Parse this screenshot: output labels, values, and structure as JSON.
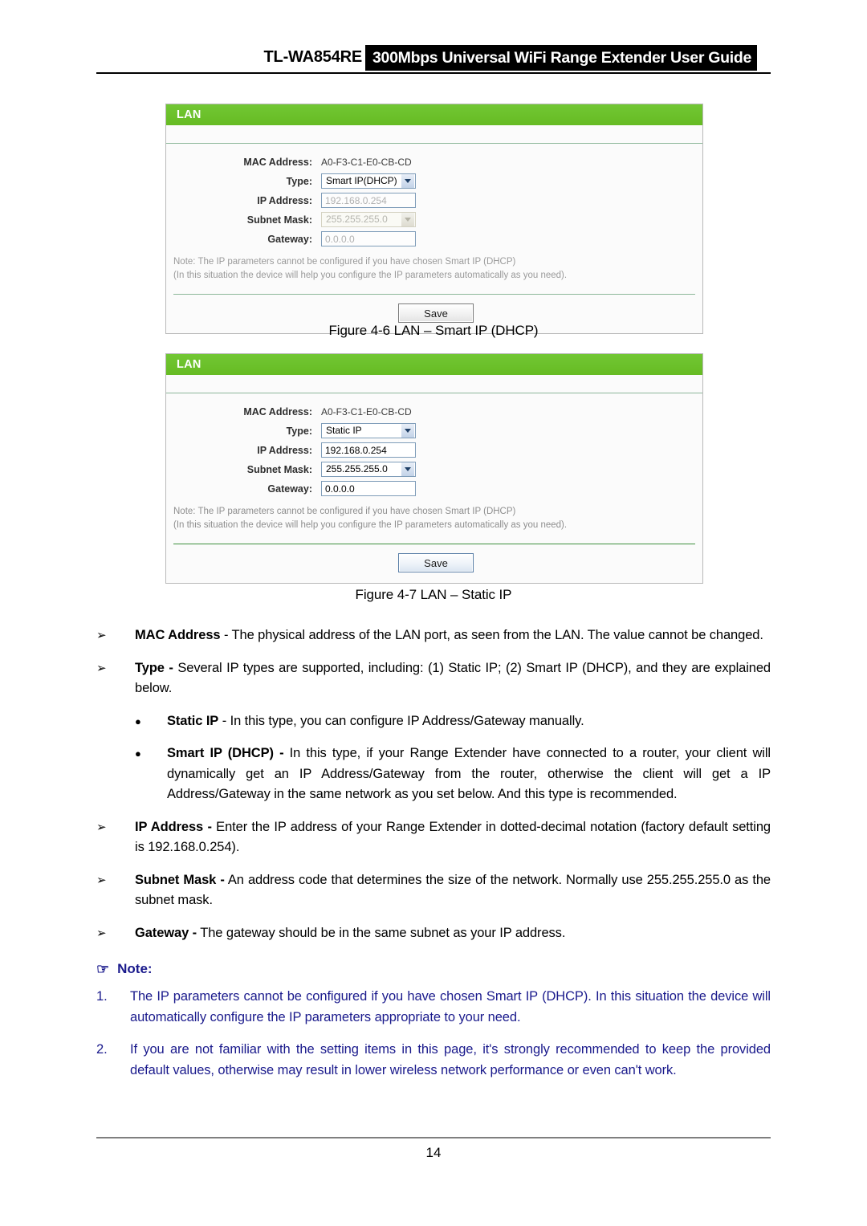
{
  "header": {
    "model": "TL-WA854RE",
    "title": "300Mbps Universal WiFi Range Extender User Guide"
  },
  "panels": [
    {
      "panel_title": "LAN",
      "rows": {
        "mac_label": "MAC Address:",
        "mac_value": "A0-F3-C1-E0-CB-CD",
        "type_label": "Type:",
        "type_value": "Smart IP(DHCP)",
        "ip_label": "IP Address:",
        "ip_value": "192.168.0.254",
        "mask_label": "Subnet Mask:",
        "mask_value": "255.255.255.0",
        "gateway_label": "Gateway:",
        "gateway_value": "0.0.0.0"
      },
      "note_line1": "Note: The IP parameters cannot be configured if you have chosen Smart IP (DHCP)",
      "note_line2": "(In this situation the device will help you configure the IP parameters automatically as you need).",
      "save_label": "Save"
    },
    {
      "panel_title": "LAN",
      "rows": {
        "mac_label": "MAC Address:",
        "mac_value": "A0-F3-C1-E0-CB-CD",
        "type_label": "Type:",
        "type_value": "Static IP",
        "ip_label": "IP Address:",
        "ip_value": "192.168.0.254",
        "mask_label": "Subnet Mask:",
        "mask_value": "255.255.255.0",
        "gateway_label": "Gateway:",
        "gateway_value": "0.0.0.0"
      },
      "note_line1": "Note: The IP parameters cannot be configured if you have chosen Smart IP (DHCP)",
      "note_line2": "(In this situation the device will help you configure the IP parameters automatically as you need).",
      "save_label": "Save"
    }
  ],
  "captions": {
    "figure_4_6": "Figure 4-6 LAN – Smart IP (DHCP)",
    "figure_4_7": "Figure 4-7 LAN – Static IP"
  },
  "bullets": {
    "mac_term": "MAC Address",
    "mac_text": " - The physical address of the LAN port, as seen from the LAN. The value cannot be changed.",
    "type_term": "Type -",
    "type_text": " Several IP types are supported, including: (1) Static IP; (2) Smart IP (DHCP), and they are explained below.",
    "static_term": "Static IP",
    "static_text": " - In this type, you can configure IP Address/Gateway manually.",
    "smart_term": "Smart IP (DHCP) -",
    "smart_text": " In this type, if your Range Extender have connected to a router, your client will dynamically get an IP Address/Gateway from the router, otherwise the client will get a IP Address/Gateway in the same network as you set below. And this type is recommended.",
    "ipaddr_term": "IP Address -",
    "ipaddr_text": " Enter the IP address of your Range Extender in dotted-decimal notation (factory default setting is 192.168.0.254).",
    "subnet_term": "Subnet Mask -",
    "subnet_text": " An address code that determines the size of the network. Normally use 255.255.255.0 as the subnet mask.",
    "gateway_term": "Gateway -",
    "gateway_text": " The gateway should be in the same subnet as your IP address."
  },
  "note": {
    "heading": "Note:",
    "hand_icon": "☞",
    "items": [
      {
        "num": "1.",
        "text": "The IP parameters cannot be configured if you have chosen Smart IP (DHCP). In this situation the device will automatically configure the IP parameters appropriate to your need."
      },
      {
        "num": "2.",
        "text": "If you are not familiar with the setting items in this page, it's strongly recommended to keep the provided default values, otherwise may result in lower wireless network performance or even can't work."
      }
    ]
  },
  "footer": {
    "page_number": "14"
  }
}
